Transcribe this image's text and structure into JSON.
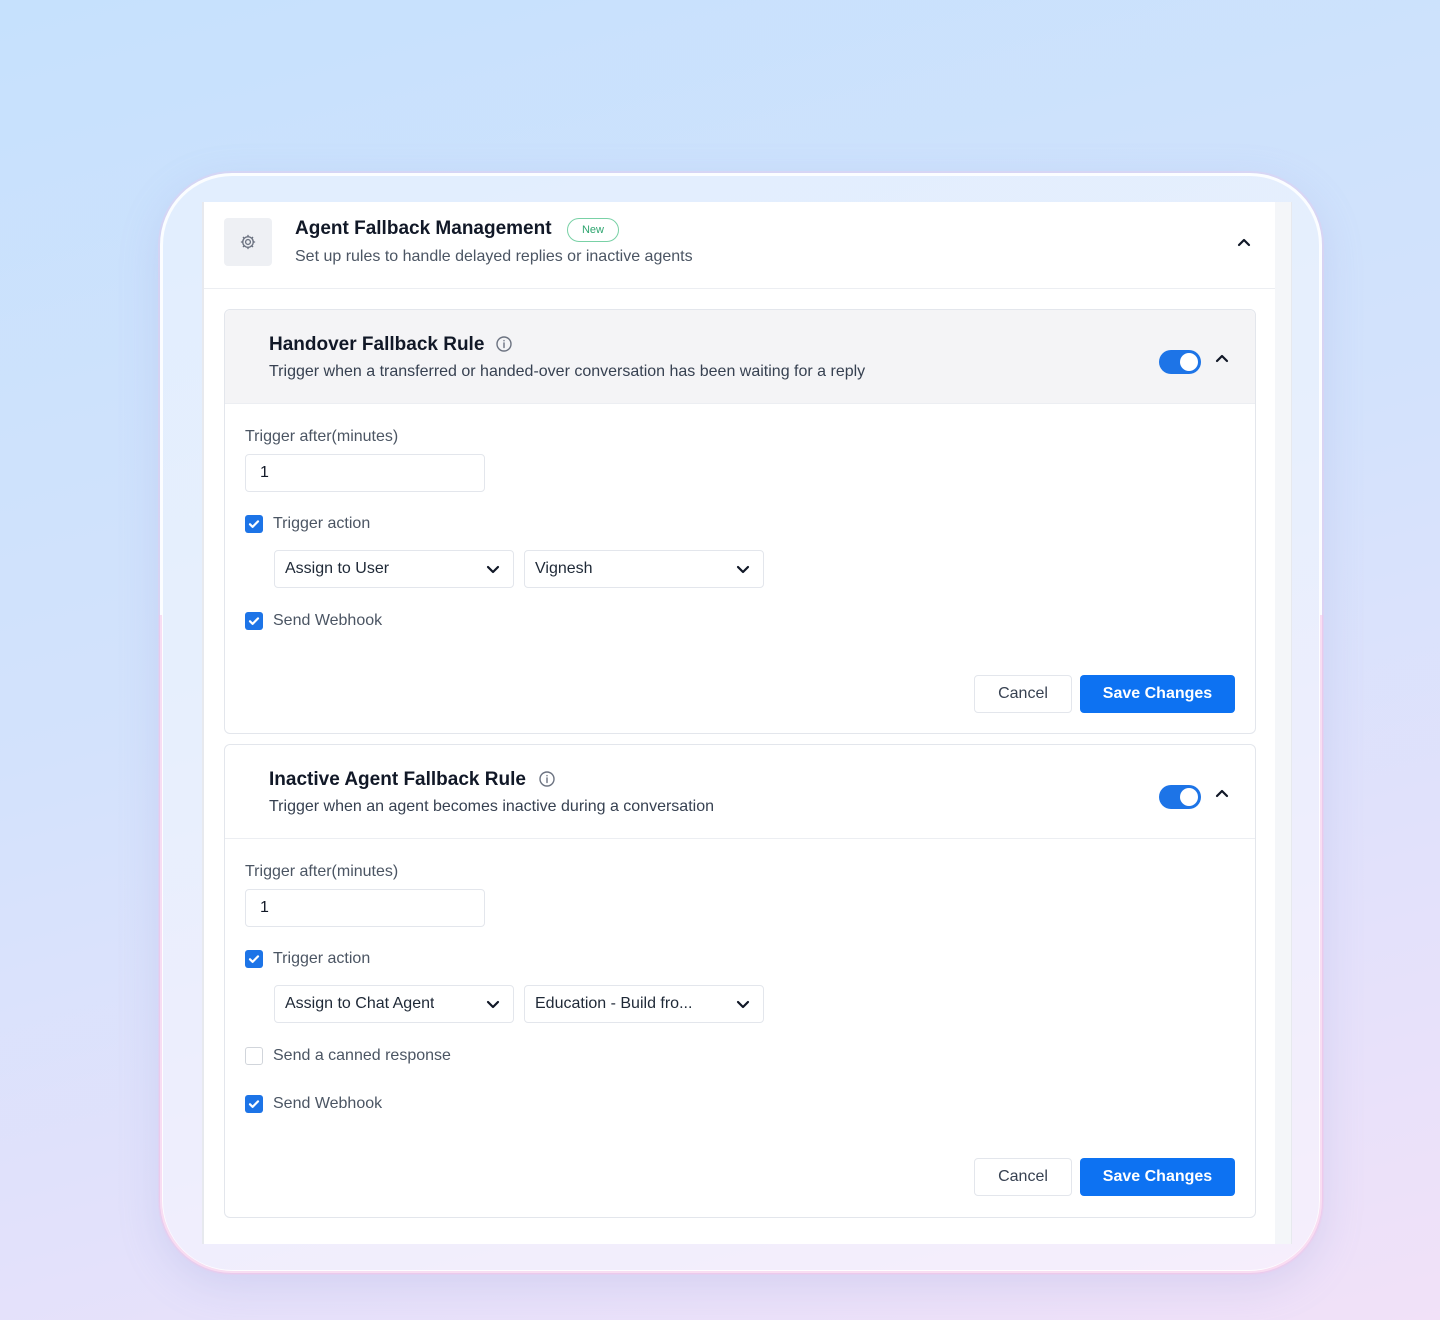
{
  "header": {
    "title": "Agent Fallback Management",
    "badge": "New",
    "subtitle": "Set up rules to handle delayed replies or inactive agents",
    "icon": "gear-icon"
  },
  "rules": [
    {
      "title": "Handover Fallback Rule",
      "subtitle": "Trigger when a transferred or handed-over conversation has been waiting for a reply",
      "enabled": true,
      "trigger_label": "Trigger after(minutes)",
      "trigger_value": "1",
      "trigger_action_label": "Trigger action",
      "trigger_action_checked": true,
      "action_select": "Assign to User",
      "target_select": "Vignesh",
      "webhook_label": "Send Webhook",
      "webhook_checked": true,
      "cancel_label": "Cancel",
      "save_label": "Save Changes"
    },
    {
      "title": "Inactive Agent Fallback Rule",
      "subtitle": "Trigger when an agent becomes inactive during a conversation",
      "enabled": true,
      "trigger_label": "Trigger after(minutes)",
      "trigger_value": "1",
      "trigger_action_label": "Trigger action",
      "trigger_action_checked": true,
      "action_select": "Assign to Chat Agent",
      "target_select": "Education - Build fro...",
      "canned_label": "Send a canned response",
      "canned_checked": false,
      "webhook_label": "Send Webhook",
      "webhook_checked": true,
      "cancel_label": "Cancel",
      "save_label": "Save Changes"
    }
  ],
  "colors": {
    "accent": "#0d72f2",
    "toggle_on": "#1d74e7",
    "badge_green": "#2ea56f"
  }
}
